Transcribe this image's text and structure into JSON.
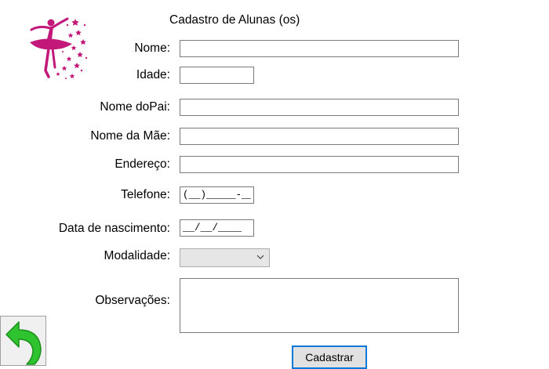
{
  "form": {
    "title": "Cadastro de Alunas (os)",
    "labels": {
      "nome": "Nome:",
      "idade": "Idade:",
      "nome_pai": "Nome doPai:",
      "nome_mae": "Nome da Mãe:",
      "endereco": "Endereço:",
      "telefone": "Telefone:",
      "data_nascimento": "Data de nascimento:",
      "modalidade": "Modalidade:",
      "observacoes": "Observações:"
    },
    "values": {
      "nome": "",
      "idade": "",
      "nome_pai": "",
      "nome_mae": "",
      "endereco": "",
      "telefone": "(__)_____-____",
      "data_nascimento": "__/__/____",
      "modalidade": "",
      "observacoes": ""
    },
    "submit_label": "Cadastrar"
  },
  "icons": {
    "logo": "ballerina-logo",
    "back": "back-arrow-icon",
    "dropdown": "chevron-down-icon"
  },
  "colors": {
    "logo_pink": "#c2187a",
    "back_arrow_green": "#2fc42f",
    "button_border": "#0078d7"
  }
}
